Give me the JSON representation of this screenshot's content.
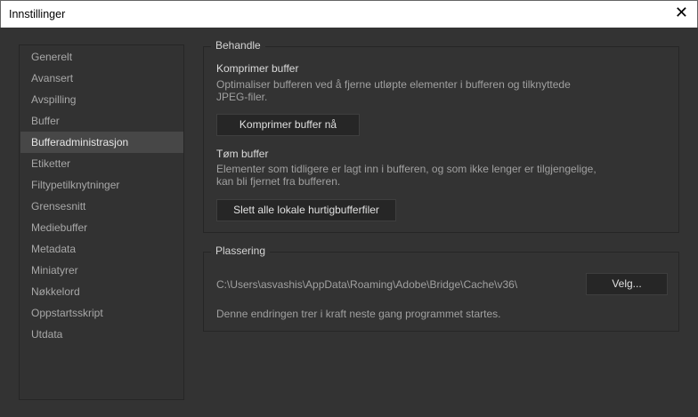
{
  "window": {
    "title": "Innstillinger",
    "close_label": "✕"
  },
  "sidebar": {
    "items": [
      {
        "label": "Generelt"
      },
      {
        "label": "Avansert"
      },
      {
        "label": "Avspilling"
      },
      {
        "label": "Buffer"
      },
      {
        "label": "Bufferadministrasjon",
        "selected": true
      },
      {
        "label": "Etiketter"
      },
      {
        "label": "Filtypetilknytninger"
      },
      {
        "label": "Grensesnitt"
      },
      {
        "label": "Mediebuffer"
      },
      {
        "label": "Metadata"
      },
      {
        "label": "Miniatyrer"
      },
      {
        "label": "Nøkkelord"
      },
      {
        "label": "Oppstartsskript"
      },
      {
        "label": "Utdata"
      }
    ]
  },
  "behandle": {
    "legend": "Behandle",
    "compress": {
      "title": "Komprimer buffer",
      "desc1": "Optimaliser bufferen ved å fjerne utløpte elementer i bufferen og tilknyttede",
      "desc2": "JPEG-filer.",
      "button": "Komprimer buffer nå"
    },
    "purge": {
      "title": "Tøm buffer",
      "desc1": "Elementer som tidligere er lagt inn i bufferen, og som ikke lenger er tilgjengelige,",
      "desc2": "kan bli fjernet fra bufferen.",
      "button": "Slett alle lokale hurtigbufferfiler"
    }
  },
  "plassering": {
    "legend": "Plassering",
    "path": "C:\\Users\\asvashis\\AppData\\Roaming\\Adobe\\Bridge\\Cache\\v36\\",
    "choose_button": "Velg...",
    "note": "Denne endringen trer i kraft neste gang programmet startes."
  }
}
